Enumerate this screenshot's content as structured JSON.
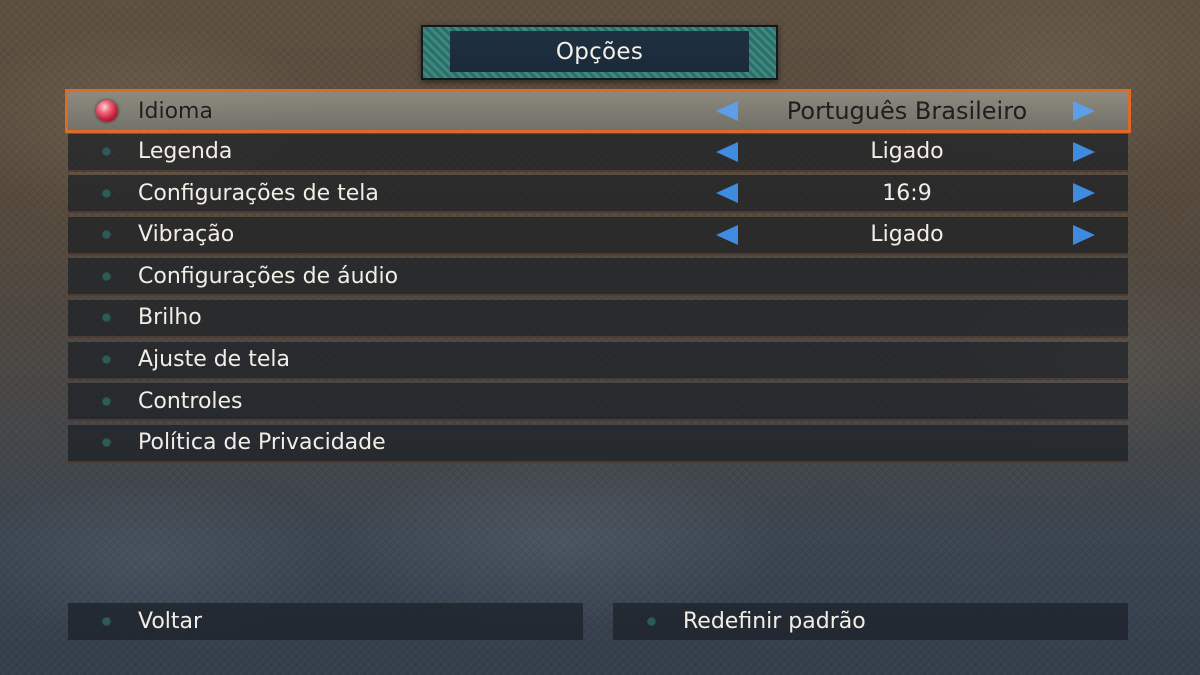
{
  "header": {
    "title": "Opções"
  },
  "menu": {
    "items": [
      {
        "label": "Idioma",
        "value": "Português Brasileiro",
        "selected": true
      },
      {
        "label": "Legenda",
        "value": "Ligado"
      },
      {
        "label": "Configurações de tela",
        "value": "16:9"
      },
      {
        "label": "Vibração",
        "value": "Ligado"
      },
      {
        "label": "Configurações de áudio"
      },
      {
        "label": "Brilho"
      },
      {
        "label": "Ajuste de tela"
      },
      {
        "label": "Controles"
      },
      {
        "label": "Política de Privacidade"
      }
    ]
  },
  "footer": {
    "back_label": "Voltar",
    "reset_label": "Redefinir padrão"
  },
  "colors": {
    "selection_outline": "#e0692a",
    "arrow": "#3f8be0",
    "bullet": "#2f5a55",
    "active_bullet": "#c4213c"
  },
  "icons": {
    "left_arrow": "left-triangle",
    "right_arrow": "right-triangle",
    "selector": "red-orb"
  }
}
